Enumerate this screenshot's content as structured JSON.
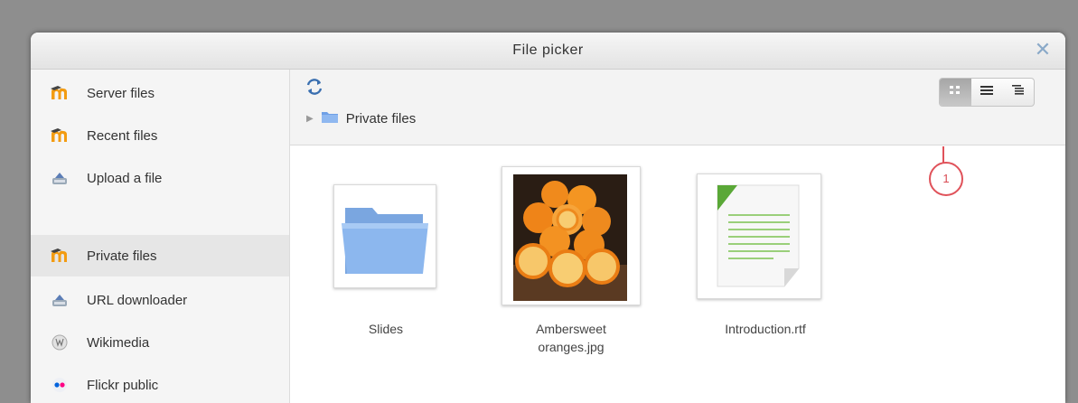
{
  "dialog": {
    "title": "File picker",
    "close_label": "✕"
  },
  "sidebar": {
    "items": [
      {
        "label": "Server files",
        "icon": "moodle-icon",
        "active": false
      },
      {
        "label": "Recent files",
        "icon": "moodle-icon",
        "active": false
      },
      {
        "label": "Upload a file",
        "icon": "upload-icon",
        "active": false
      },
      {
        "label": "Private files",
        "icon": "moodle-icon",
        "active": true
      },
      {
        "label": "URL downloader",
        "icon": "url-download-icon",
        "active": false
      },
      {
        "label": "Wikimedia",
        "icon": "wikimedia-icon",
        "active": false
      },
      {
        "label": "Flickr public",
        "icon": "flickr-icon",
        "active": false
      }
    ]
  },
  "toolbar": {
    "breadcrumb": "Private files",
    "view_modes": [
      "icons",
      "list",
      "tree"
    ],
    "active_view": "icons"
  },
  "annotation": {
    "number": "1"
  },
  "files": [
    {
      "name": "Slides",
      "type": "folder"
    },
    {
      "name": "Ambersweet oranges.jpg",
      "type": "image"
    },
    {
      "name": "Introduction.rtf",
      "type": "document"
    }
  ],
  "colors": {
    "accent": "#8aa9c8",
    "annotation": "#e0525a",
    "folder": "#6fa0e6",
    "moodle_orange": "#f39c12"
  }
}
